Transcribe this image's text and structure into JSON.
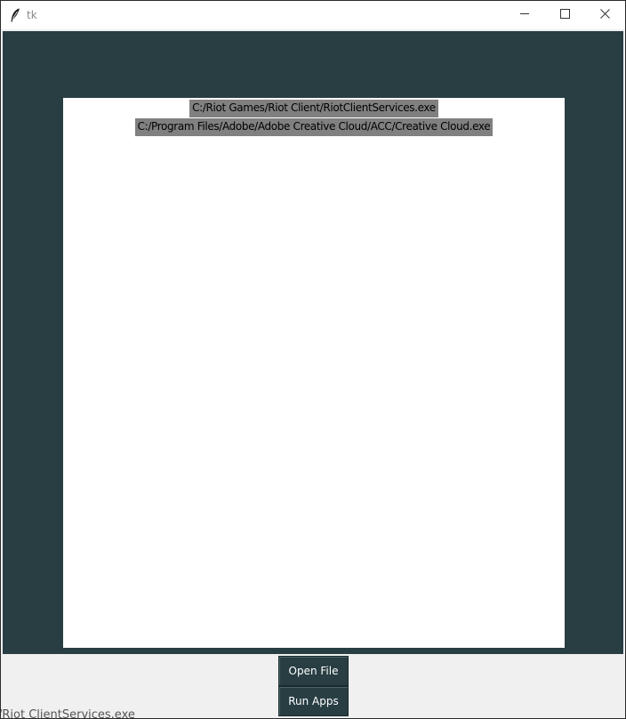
{
  "window": {
    "title": "tk",
    "controls": {
      "minimize_icon": "minimize-icon",
      "maximize_icon": "maximize-icon",
      "close_icon": "close-icon"
    }
  },
  "canvas": {
    "background_color": "#283e43",
    "list_background_color": "#ffffff",
    "files": [
      "C:/Riot Games/Riot Client/RiotClientServices.exe",
      "C:/Program Files/Adobe/Adobe Creative Cloud/ACC/Creative Cloud.exe"
    ]
  },
  "buttons": {
    "open_file": "Open File",
    "run_apps": "Run Apps"
  },
  "background_text": "/Riot ClientServices.exe"
}
